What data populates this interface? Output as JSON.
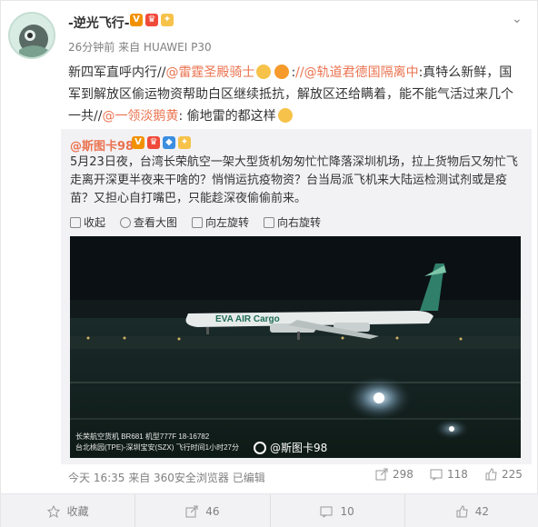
{
  "post": {
    "author": "-逆光飞行-",
    "time": "26分钟前",
    "source": "来自 HUAWEI P30",
    "text_a": "新四军直呼内行//",
    "mention_1": "@雷霆圣殿骑士",
    "text_b": ":",
    "mention_2": "//@轨道君德国隔离中",
    "text_c": ":真特么新鲜，国军到解放区偷运物资帮助白区继续抵抗，解放区还给瞒着，能不能气活过来几个一共//",
    "mention_3": "@一领淡鹅黄",
    "text_d": ": 偷地雷的都这样"
  },
  "repost": {
    "author": "@斯图卡98",
    "text": "5月23日夜，台湾长荣航空一架大型货机匆匆忙忙降落深圳机场，拉上货物后又匆忙飞走离开深更半夜来干啥的？悄悄运抗疫物资？台当局派飞机来大陆运检测试剂或是疫苗？又担心自打嘴巴，只能趁深夜偷偷前来。",
    "tools": {
      "collapse": "收起",
      "view_large": "查看大图",
      "rotate_left": "向左旋转",
      "rotate_right": "向右旋转"
    },
    "image": {
      "plane_text": "EVA AIR Cargo",
      "caption_1": "长荣航空货机 BR681 机型777F 18-16782",
      "caption_2": "台北桃园(TPE)-深圳宝安(SZX) 飞行时间1小时27分",
      "watermark": "@斯图卡98"
    },
    "footer": "今天 16:35 来自 360安全浏览器 已编辑",
    "reposts": "298",
    "comments": "118",
    "likes": "225"
  },
  "actions": {
    "favorite": "收藏",
    "repost": "46",
    "comment": "10",
    "like": "42"
  },
  "colors": {
    "link": "#eb7350",
    "meta": "#808080"
  }
}
